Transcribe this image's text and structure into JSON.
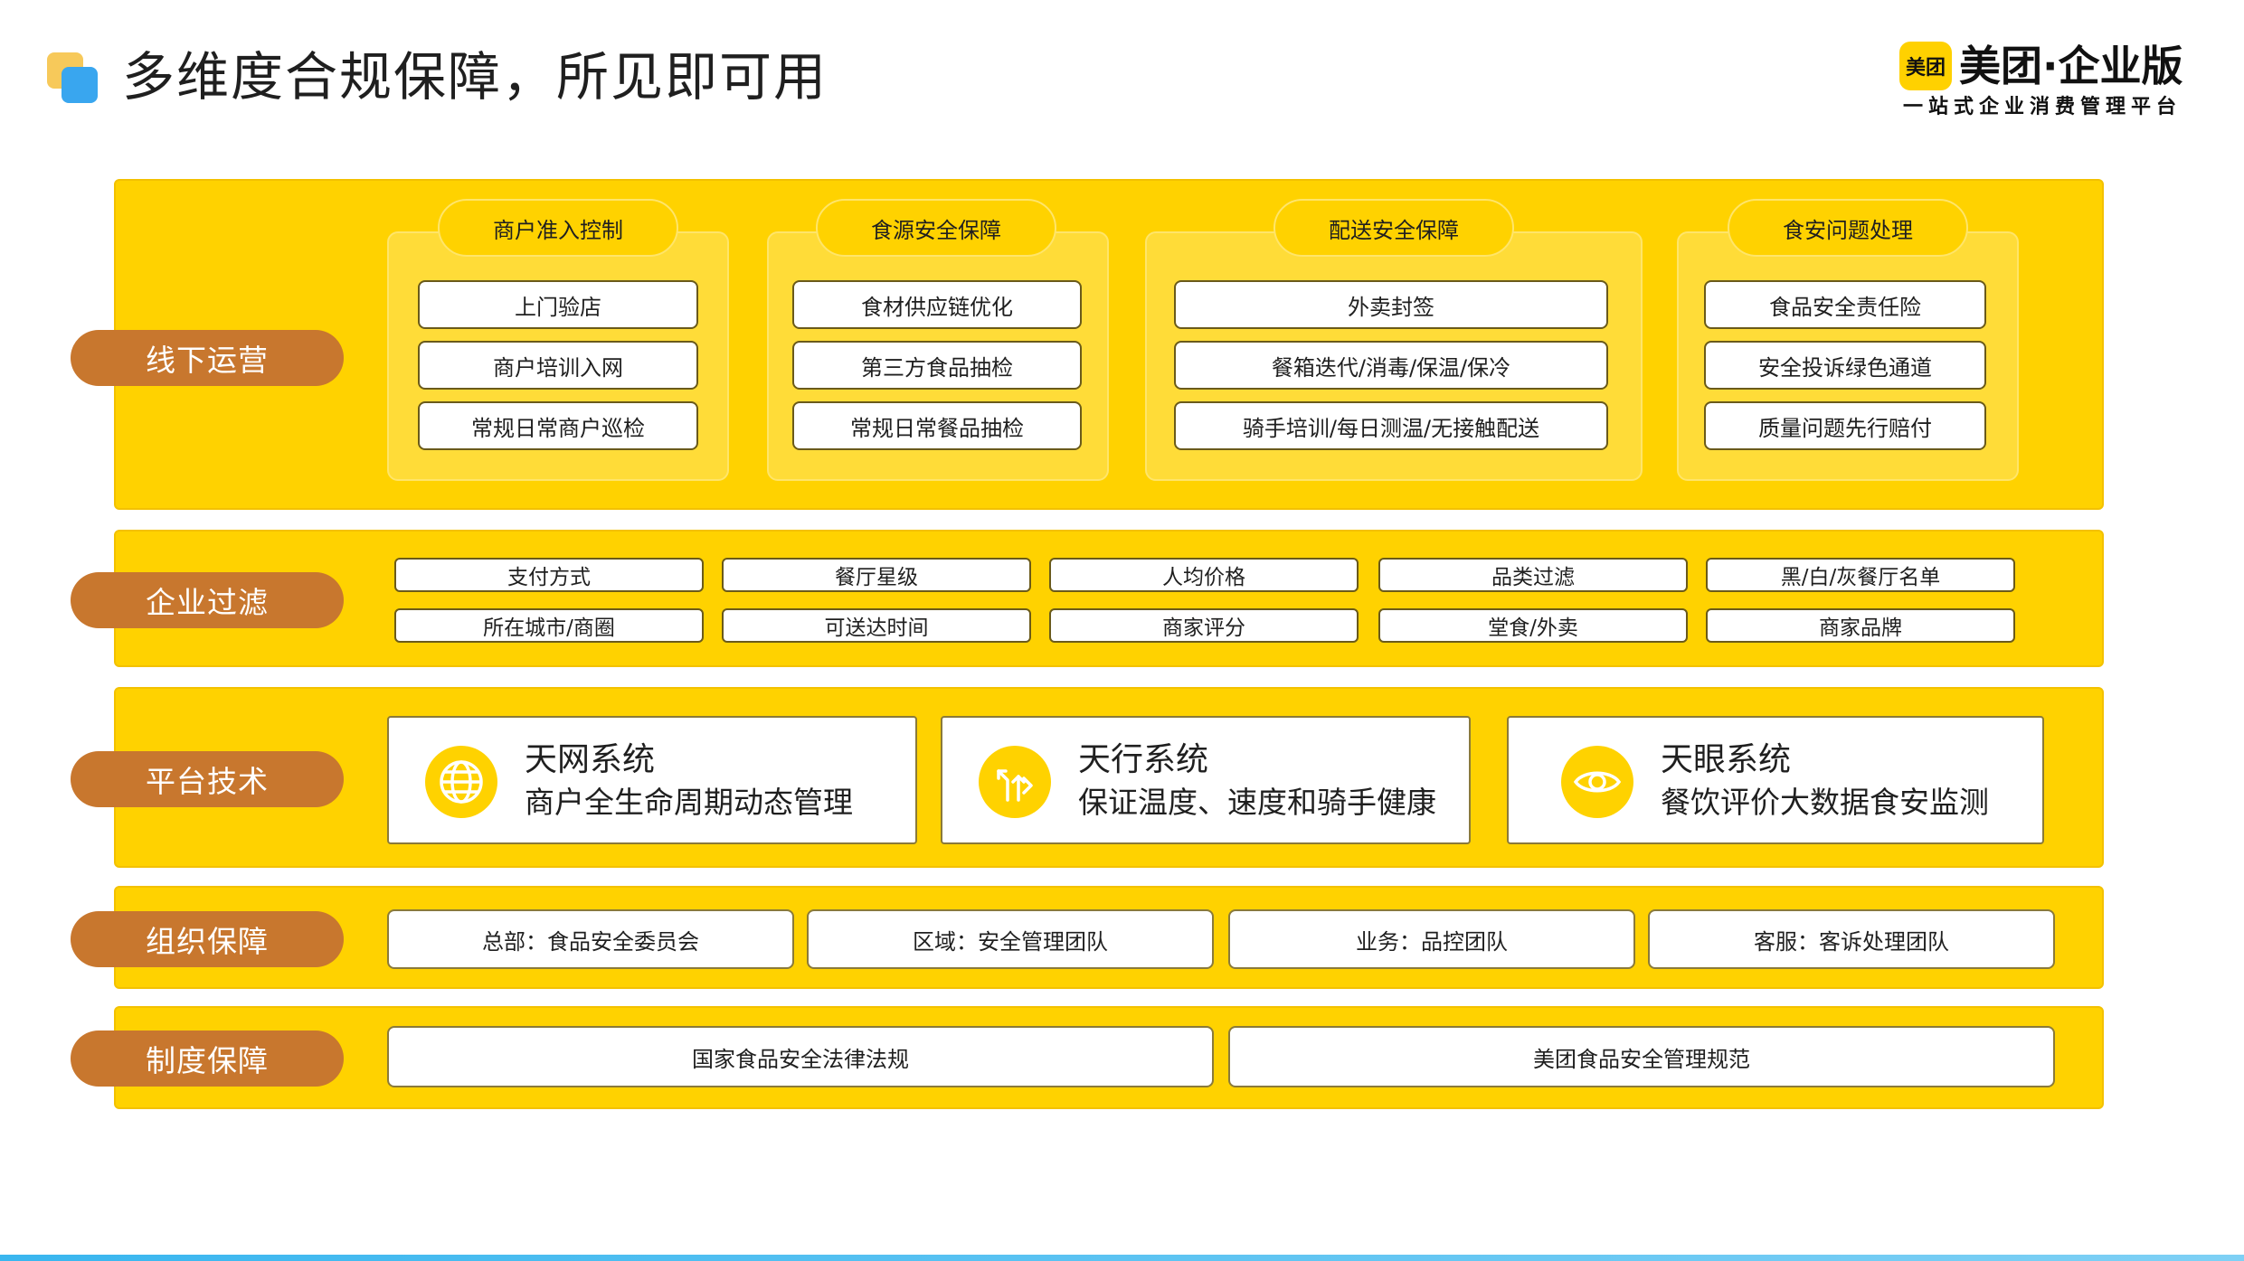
{
  "header": {
    "title": "多维度合规保障，所见即可用",
    "logo_badge": "美团",
    "logo_name": "美团·企业版",
    "logo_tagline": "一站式企业消费管理平台"
  },
  "rows": {
    "offline": {
      "label": "线下运营",
      "panels": [
        {
          "title": "商户准入控制",
          "items": [
            "上门验店",
            "商户培训入网",
            "常规日常商户巡检"
          ]
        },
        {
          "title": "食源安全保障",
          "items": [
            "食材供应链优化",
            "第三方食品抽检",
            "常规日常餐品抽检"
          ]
        },
        {
          "title": "配送安全保障",
          "items": [
            "外卖封签",
            "餐箱迭代/消毒/保温/保冷",
            "骑手培训/每日测温/无接触配送"
          ]
        },
        {
          "title": "食安问题处理",
          "items": [
            "食品安全责任险",
            "安全投诉绿色通道",
            "质量问题先行赔付"
          ]
        }
      ]
    },
    "filter": {
      "label": "企业过滤",
      "items": [
        "支付方式",
        "餐厅星级",
        "人均价格",
        "品类过滤",
        "黑/白/灰餐厅名单",
        "所在城市/商圈",
        "可送达时间",
        "商家评分",
        "堂食/外卖",
        "商家品牌"
      ]
    },
    "tech": {
      "label": "平台技术",
      "cards": [
        {
          "icon": "globe-icon",
          "title": "天网系统",
          "desc": "商户全生命周期动态管理"
        },
        {
          "icon": "route-arrows-icon",
          "title": "天行系统",
          "desc": "保证温度、速度和骑手健康"
        },
        {
          "icon": "eye-icon",
          "title": "天眼系统",
          "desc": "餐饮评价大数据食安监测"
        }
      ]
    },
    "org": {
      "label": "组织保障",
      "items": [
        "总部：食品安全委员会",
        "区域：安全管理团队",
        "业务：品控团队",
        "客服：客诉处理团队"
      ]
    },
    "policy": {
      "label": "制度保障",
      "items": [
        "国家食品安全法律法规",
        "美团食品安全管理规范"
      ]
    }
  },
  "colors": {
    "band": "#ffd200",
    "label": "#c8772e",
    "accent_blue": "#39a6ef"
  }
}
